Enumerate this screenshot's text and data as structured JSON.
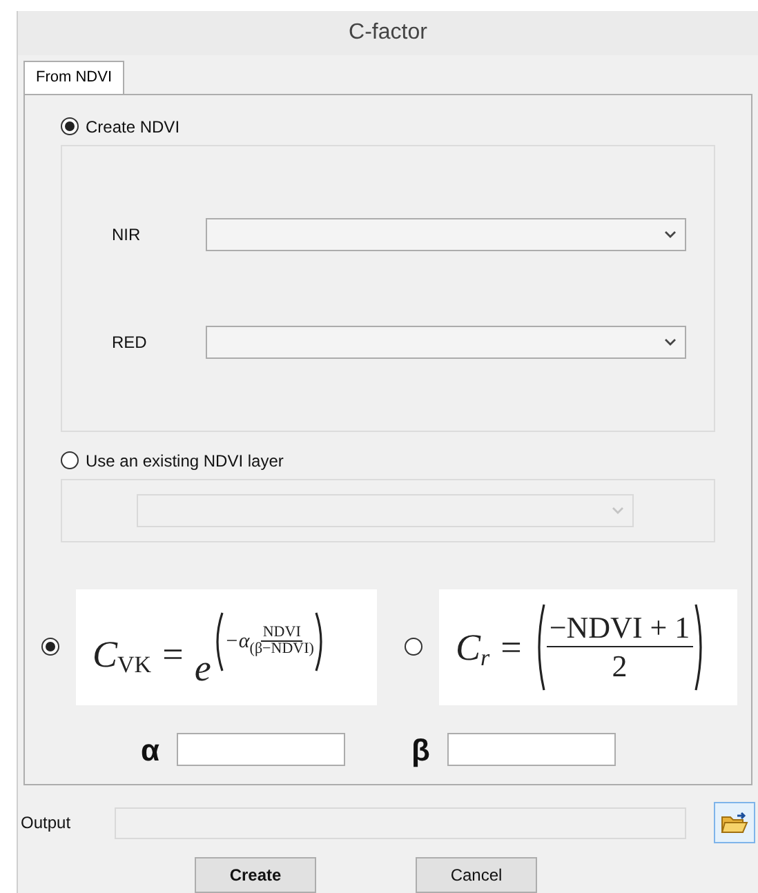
{
  "window": {
    "title": "C-factor"
  },
  "tabs": [
    {
      "label": "From NDVI",
      "selected": true
    }
  ],
  "sources": [
    {
      "label": "Create NDVI",
      "selected": true,
      "fields": [
        {
          "label": "NIR",
          "disabled": false
        },
        {
          "label": "RED",
          "disabled": false
        }
      ]
    },
    {
      "label": "Use an existing NDVI layer",
      "selected": false,
      "fields": [
        {
          "disabled": true
        }
      ]
    }
  ],
  "formulas": [
    {
      "kind": "exponential",
      "selected": true,
      "symbol": "C",
      "subscript": "VK",
      "equals": "=",
      "base": "e",
      "prefix": "−α",
      "numerator": "NDVI",
      "denominator": "(β−NDVI)"
    },
    {
      "kind": "fraction",
      "selected": false,
      "symbol": "C",
      "subscript": "r",
      "equals": "=",
      "numerator": "−NDVI + 1",
      "denominator": "2"
    }
  ],
  "parameters": [
    {
      "label": "α"
    },
    {
      "label": "β"
    }
  ],
  "output": {
    "label": "Output"
  },
  "buttons": [
    {
      "label": "Create",
      "default": true
    },
    {
      "label": "Cancel",
      "default": false
    }
  ]
}
